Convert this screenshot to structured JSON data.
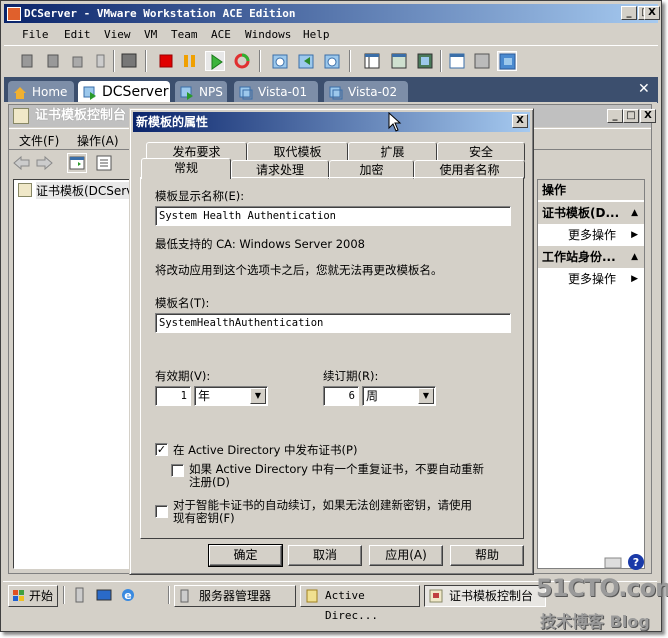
{
  "window": {
    "title": "DCServer - VMware Workstation ACE Edition",
    "controls": {
      "minimize": "_",
      "maximize": "□",
      "close": "X"
    }
  },
  "menu": [
    "File",
    "Edit",
    "View",
    "VM",
    "Team",
    "ACE",
    "Windows",
    "Help"
  ],
  "toolbar": {
    "icons": [
      "snapshot-icon",
      "revert-icon",
      "cdrom-icon",
      "usb-icon",
      "console-icon",
      "stop-icon",
      "pause-icon",
      "play-icon",
      "reset-icon",
      "take-snapshot-icon",
      "revert-snapshot-icon",
      "snapshot-manager-icon",
      "sidebar-icon",
      "fullscreen-icon",
      "quick-switch-icon",
      "settings-icon",
      "summary-icon",
      "console-view-icon"
    ]
  },
  "vm_tabs": [
    {
      "label": "Home",
      "active": false
    },
    {
      "label": "DCServer",
      "active": true
    },
    {
      "label": "NPS",
      "active": false
    },
    {
      "label": "Vista-01",
      "active": false
    },
    {
      "label": "Vista-02",
      "active": false
    }
  ],
  "vm_tabs_close": "✕",
  "mmc": {
    "title": "证书模板控制台",
    "menu": [
      "文件(F)",
      "操作(A)"
    ],
    "tree_item": "证书模板(DCServe",
    "actions": {
      "header": "操作",
      "groups": [
        {
          "title": "证书模板(D...",
          "item": "更多操作"
        },
        {
          "title": "工作站身份...",
          "item": "更多操作"
        }
      ]
    }
  },
  "dialog": {
    "title": "新模板的属性",
    "close": "X",
    "tabs_row1": [
      "发布要求",
      "取代模板",
      "扩展",
      "安全"
    ],
    "tabs_row2": [
      "常规",
      "请求处理",
      "加密",
      "使用者名称"
    ],
    "active_tab": "常规",
    "display_name_label": "模板显示名称(E):",
    "display_name_value": "System Health Authentication",
    "min_ca": "最低支持的 CA: Windows Server 2008",
    "warning": "将改动应用到这个选项卡之后，您就无法再更改模板名。",
    "template_name_label": "模板名(T):",
    "template_name_value": "SystemHealthAuthentication",
    "validity_label": "有效期(V):",
    "validity_value": "1",
    "validity_unit": "年",
    "renewal_label": "续订期(R):",
    "renewal_value": "6",
    "renewal_unit": "周",
    "publish_ad": {
      "label": "在 Active Directory 中发布证书(P)",
      "checked": true
    },
    "no_reenroll": {
      "label_line1": "如果 Active Directory 中有一个重复证书，不要自动重新",
      "label_line2": "注册(D)",
      "checked": false
    },
    "smartcard": {
      "label_line1": "对于智能卡证书的自动续订，如果无法创建新密钥，请使用",
      "label_line2": "现有密钥(F)",
      "checked": false
    },
    "buttons": {
      "ok": "确定",
      "cancel": "取消",
      "apply": "应用(A)",
      "help": "帮助"
    }
  },
  "taskbar": {
    "start": "开始",
    "tasks": [
      {
        "label": "服务器管理器",
        "pressed": false
      },
      {
        "label": "Active Direc...",
        "pressed": false
      },
      {
        "label": "证书模板控制台",
        "pressed": true
      }
    ]
  },
  "watermark": {
    "line1": "51CTO.com",
    "line2": "技术博客 Blog"
  }
}
